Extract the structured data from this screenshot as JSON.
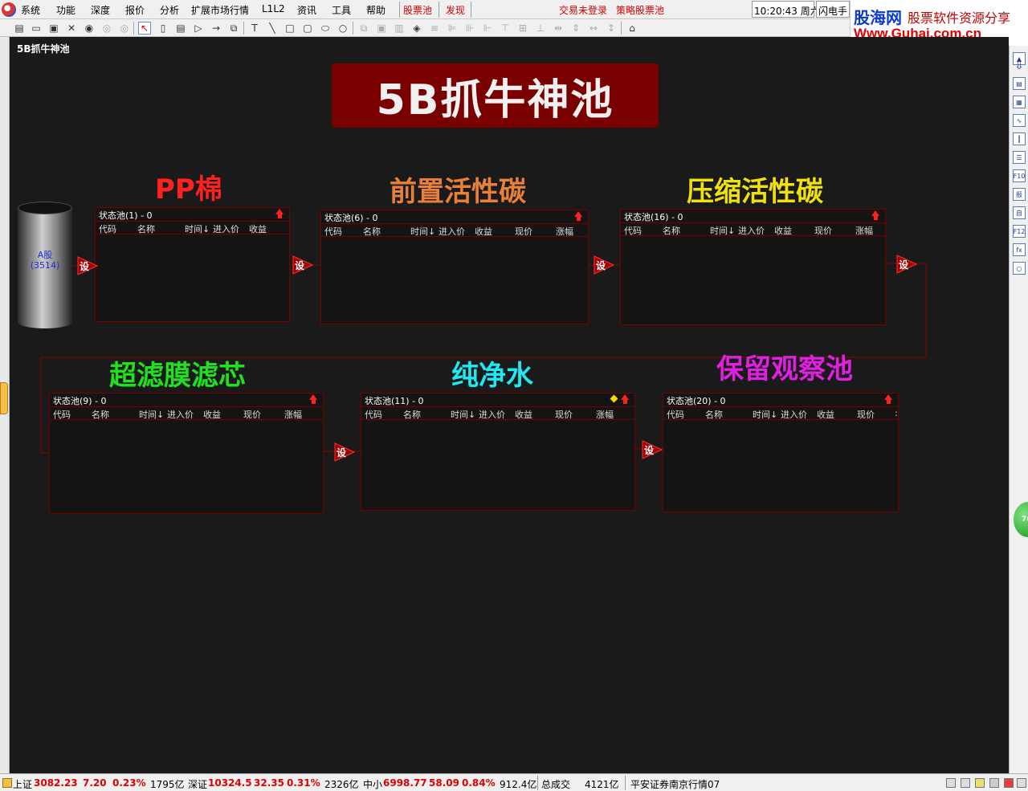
{
  "menubar": {
    "items": [
      "系统",
      "功能",
      "深度",
      "报价",
      "分析",
      "扩展市场行情",
      "L1L2",
      "资讯",
      "工具",
      "帮助"
    ],
    "highlight": [
      "股票池",
      "发现"
    ],
    "login_status": "交易未登录",
    "strategy_pool": "策略股票池",
    "clock": "10:20:43 周六",
    "flash_trade": "闪电手"
  },
  "banner": {
    "brand": "股海网",
    "slogan": "股票软件资源分享",
    "url": "Www.Guhai.com.cn"
  },
  "canvas": {
    "title": "5B抓牛神池",
    "main_title": "5B抓牛神池",
    "source": {
      "name": "A股",
      "count": "(3514)"
    },
    "set_label": "设",
    "stages": [
      {
        "title": "PP棉",
        "color": "#ff2020",
        "pool_title": "状态池(1) - 0",
        "columns": [
          "代码",
          "名称",
          "时间↓",
          "进入价",
          "收益"
        ]
      },
      {
        "title": "前置活性碳",
        "color": "#e8803a",
        "pool_title": "状态池(6) - 0",
        "columns": [
          "代码",
          "名称",
          "时间↓",
          "进入价",
          "收益",
          "现价",
          "涨幅"
        ]
      },
      {
        "title": "压缩活性碳",
        "color": "#f0e010",
        "pool_title": "状态池(16) - 0",
        "columns": [
          "代码",
          "名称",
          "时间↓",
          "进入价",
          "收益",
          "现价",
          "涨幅"
        ]
      },
      {
        "title": "超滤膜滤芯",
        "color": "#20e020",
        "pool_title": "状态池(9) - 0",
        "columns": [
          "代码",
          "名称",
          "时间↓",
          "进入价",
          "收益",
          "现价",
          "涨幅"
        ]
      },
      {
        "title": "纯净水",
        "color": "#20e8f0",
        "pool_title": "状态池(11) - 0",
        "columns": [
          "代码",
          "名称",
          "时间↓",
          "进入价",
          "收益",
          "现价",
          "涨幅"
        ]
      },
      {
        "title": "保留观察池",
        "color": "#e020e0",
        "pool_title": "状态池(20) - 0",
        "columns": [
          "代码",
          "名称",
          "时间↓",
          "进入价",
          "收益",
          "现价",
          ":"
        ]
      }
    ]
  },
  "statusbar": {
    "sh_label": "上证",
    "sh_value": "3082.23",
    "sh_change": "7.20",
    "sh_pct": "0.23%",
    "sh_vol": "1795亿",
    "sz_label": "深证",
    "sz_value": "10324.5",
    "sz_change": "32.35",
    "sz_pct": "0.31%",
    "sz_vol": "2326亿",
    "zx_label": "中小",
    "zx_value": "6998.77",
    "zx_change": "58.09",
    "zx_pct": "0.84%",
    "zx_vol": "912.4亿",
    "total_label": "总成交",
    "total_value": "4121亿",
    "broker": "平安证券南京行情07"
  },
  "badge": "76"
}
